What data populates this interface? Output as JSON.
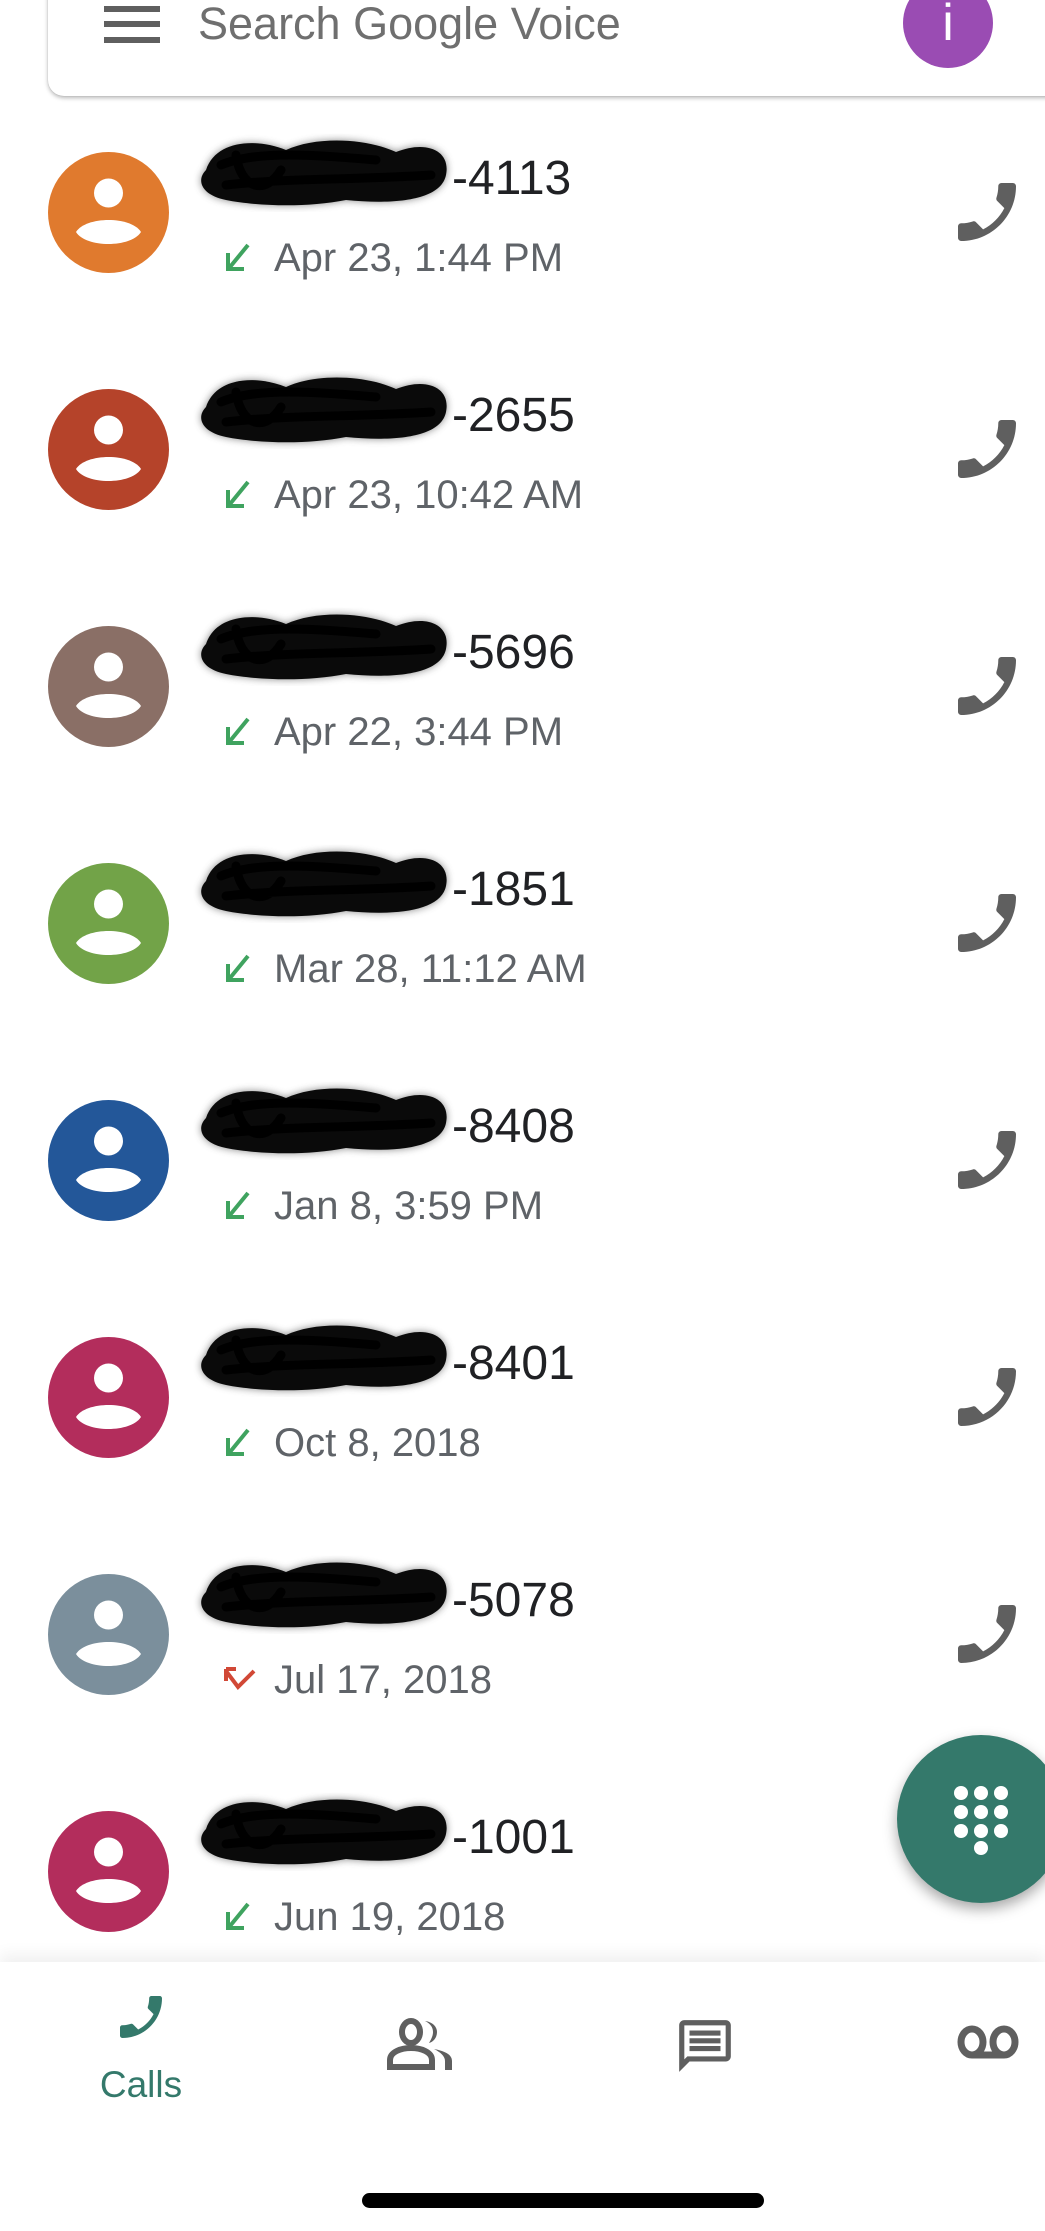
{
  "search": {
    "placeholder": "Search Google Voice",
    "menu_icon": "hamburger-menu-icon",
    "account_initial": "i",
    "account_color": "#9a4cb3"
  },
  "calls": [
    {
      "number_suffix": "-4113",
      "number_redacted": true,
      "date": "Apr 23, 1:44 PM",
      "direction": "incoming",
      "avatar_color": "#e07a2e"
    },
    {
      "number_suffix": "-2655",
      "number_redacted": true,
      "date": "Apr 23, 10:42 AM",
      "direction": "incoming",
      "avatar_color": "#b5432a"
    },
    {
      "number_suffix": "-5696",
      "number_redacted": true,
      "date": "Apr 22, 3:44 PM",
      "direction": "incoming",
      "avatar_color": "#8a6f66"
    },
    {
      "number_suffix": "-1851",
      "number_redacted": true,
      "date": "Mar 28, 11:12 AM",
      "direction": "incoming",
      "avatar_color": "#72a348"
    },
    {
      "number_suffix": "-8408",
      "number_redacted": true,
      "date": "Jan 8, 3:59 PM",
      "direction": "incoming",
      "avatar_color": "#235799"
    },
    {
      "number_suffix": "-8401",
      "number_redacted": true,
      "date": "Oct 8, 2018",
      "direction": "incoming",
      "avatar_color": "#b32d5c"
    },
    {
      "number_suffix": "-5078",
      "number_redacted": true,
      "date": "Jul 17, 2018",
      "direction": "missed",
      "avatar_color": "#7b8f9c"
    },
    {
      "number_suffix": "-1001",
      "number_redacted": true,
      "date": "Jun 19, 2018",
      "direction": "incoming",
      "avatar_color": "#b32d5c"
    }
  ],
  "colors": {
    "incoming": "#3fa35f",
    "missed": "#d14836",
    "accent": "#34796b",
    "icon_gray": "#5f5f5f"
  },
  "fab": {
    "icon": "dialpad-icon"
  },
  "bottom_nav": {
    "items": [
      {
        "id": "calls",
        "label": "Calls",
        "icon": "phone-icon",
        "active": true
      },
      {
        "id": "contacts",
        "label": "",
        "icon": "contacts-icon",
        "active": false
      },
      {
        "id": "messages",
        "label": "",
        "icon": "message-icon",
        "active": false
      },
      {
        "id": "voicemail",
        "label": "",
        "icon": "voicemail-icon",
        "active": false
      }
    ]
  }
}
